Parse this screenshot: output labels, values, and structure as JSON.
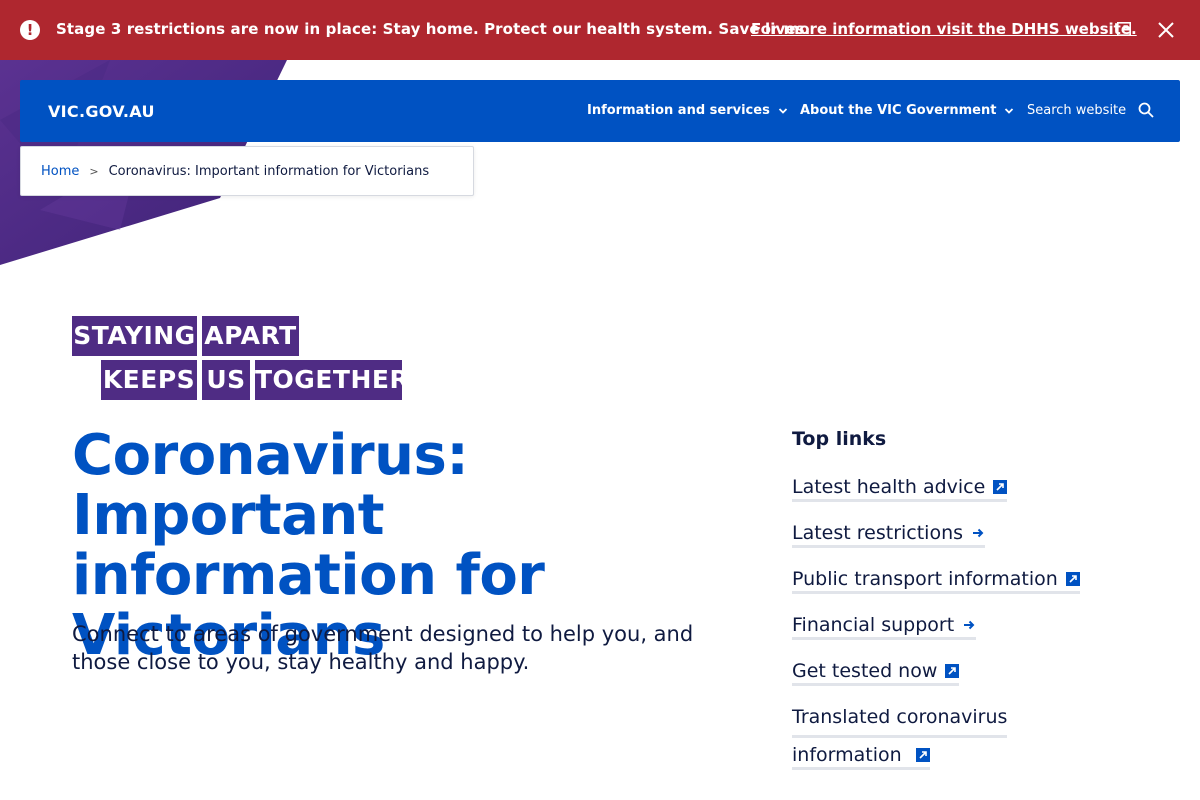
{
  "alert": {
    "text": "Stage 3 restrictions are now in place: Stay home. Protect our health system. Save lives.",
    "link": "For more information visit the DHHS website."
  },
  "header": {
    "logo": "VIC.GOV.AU",
    "nav": [
      {
        "label": "Information and services"
      },
      {
        "label": "About the VIC Government"
      }
    ],
    "search_label": "Search website"
  },
  "breadcrumb": {
    "home": "Home",
    "separator": ">",
    "current": "Coronavirus: Important information for Victorians"
  },
  "campaign": {
    "words": [
      "STAYING",
      "APART",
      "KEEPS",
      "US",
      "TOGETHER"
    ]
  },
  "main": {
    "title": "Coronavirus: Important information for Victorians",
    "intro": "Connect to areas of government designed to help you, and those close to you, stay healthy and happy."
  },
  "top_links": {
    "title": "Top links",
    "items": [
      {
        "label": "Latest health advice",
        "icon": "external-link-icon"
      },
      {
        "label": "Latest restrictions",
        "icon": "arrow-right-icon"
      },
      {
        "label": "Public transport information",
        "icon": "external-link-icon"
      },
      {
        "label": "Financial support",
        "icon": "arrow-right-icon"
      },
      {
        "label": "Get tested now",
        "icon": "external-link-icon"
      },
      {
        "label": "Translated coronavirus",
        "label2": "information",
        "icon": "external-link-icon"
      }
    ]
  },
  "colors": {
    "alert": "#af272f",
    "header": "#0052c2",
    "campaign": "#4f2c84",
    "title": "#0052c2",
    "text": "#0f1a40"
  }
}
